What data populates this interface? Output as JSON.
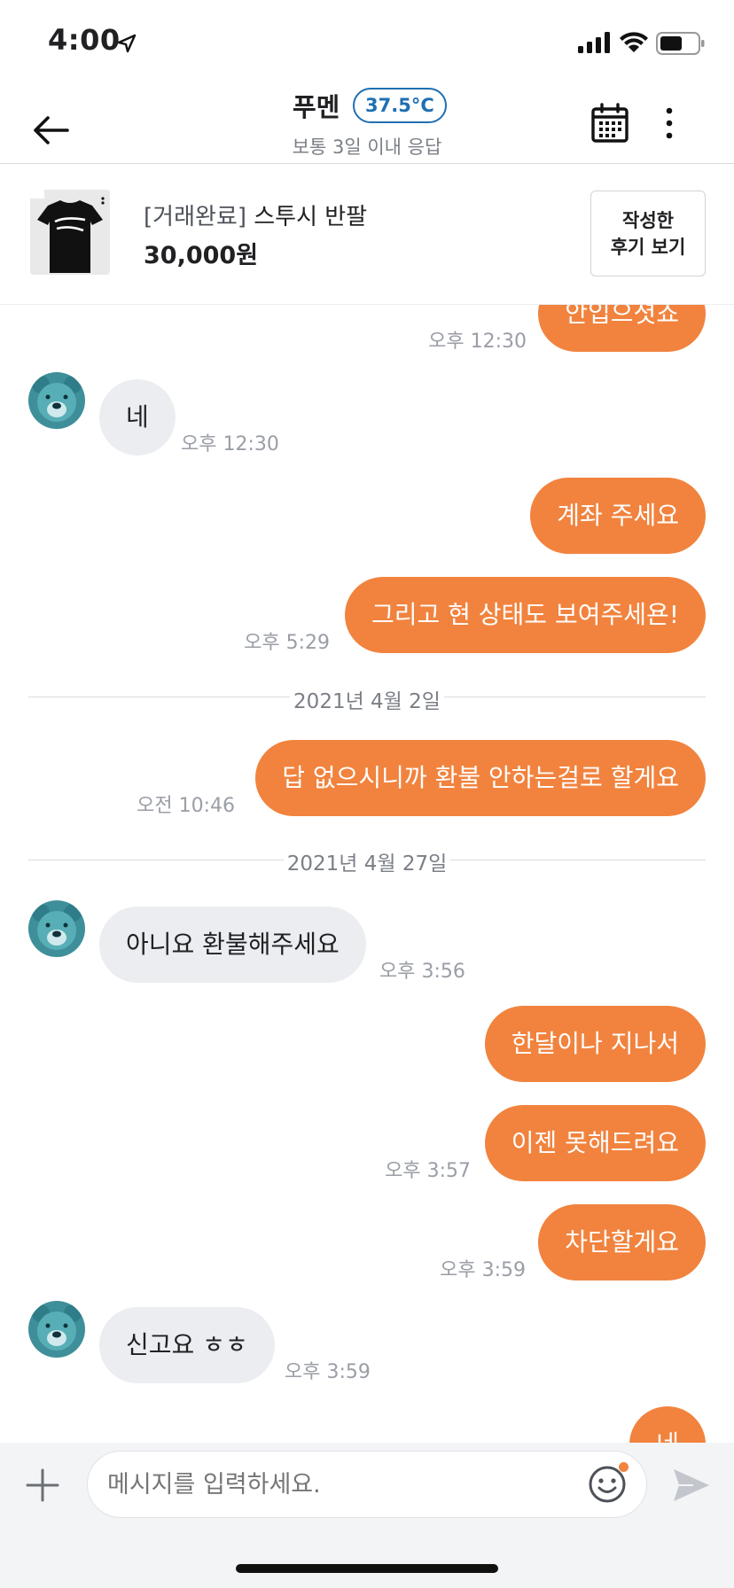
{
  "status": {
    "time": "4:00"
  },
  "header": {
    "nickname": "푸멘",
    "temperature": "37.5°C",
    "response": "보통 3일 이내 응답"
  },
  "product": {
    "status": "[거래완료]",
    "title": "스투시 반팔",
    "price": "30,000원",
    "review_button_line1": "작성한",
    "review_button_line2": "후기 보기"
  },
  "messages": {
    "m1": {
      "text": "안입으셧죠",
      "time": "오후 12:30"
    },
    "m2": {
      "text": "네",
      "time": "오후 12:30"
    },
    "m3": {
      "text": "계좌 주세요"
    },
    "m4": {
      "text": "그리고 현 상태도 보여주세욘!",
      "time": "오후 5:29"
    },
    "date1": "2021년 4월 2일",
    "m5": {
      "text": "답 없으시니까 환불 안하는걸로 할게요",
      "time": "오전 10:46"
    },
    "date2": "2021년 4월 27일",
    "m6": {
      "text": "아니요 환불해주세요",
      "time": "오후 3:56"
    },
    "m7": {
      "text": "한달이나 지나서"
    },
    "m8": {
      "text": "이젠 못해드려요",
      "time": "오후 3:57"
    },
    "m9": {
      "text": "차단할게요",
      "time": "오후 3:59"
    },
    "m10": {
      "text": "신고요 ㅎㅎ",
      "time": "오후 3:59"
    },
    "m11": {
      "text": "네"
    }
  },
  "input": {
    "placeholder": "메시지를 입력하세요."
  },
  "colors": {
    "accent": "#f1833e",
    "badge": "#1f6fb2",
    "bubble_other": "#ebedf0"
  }
}
